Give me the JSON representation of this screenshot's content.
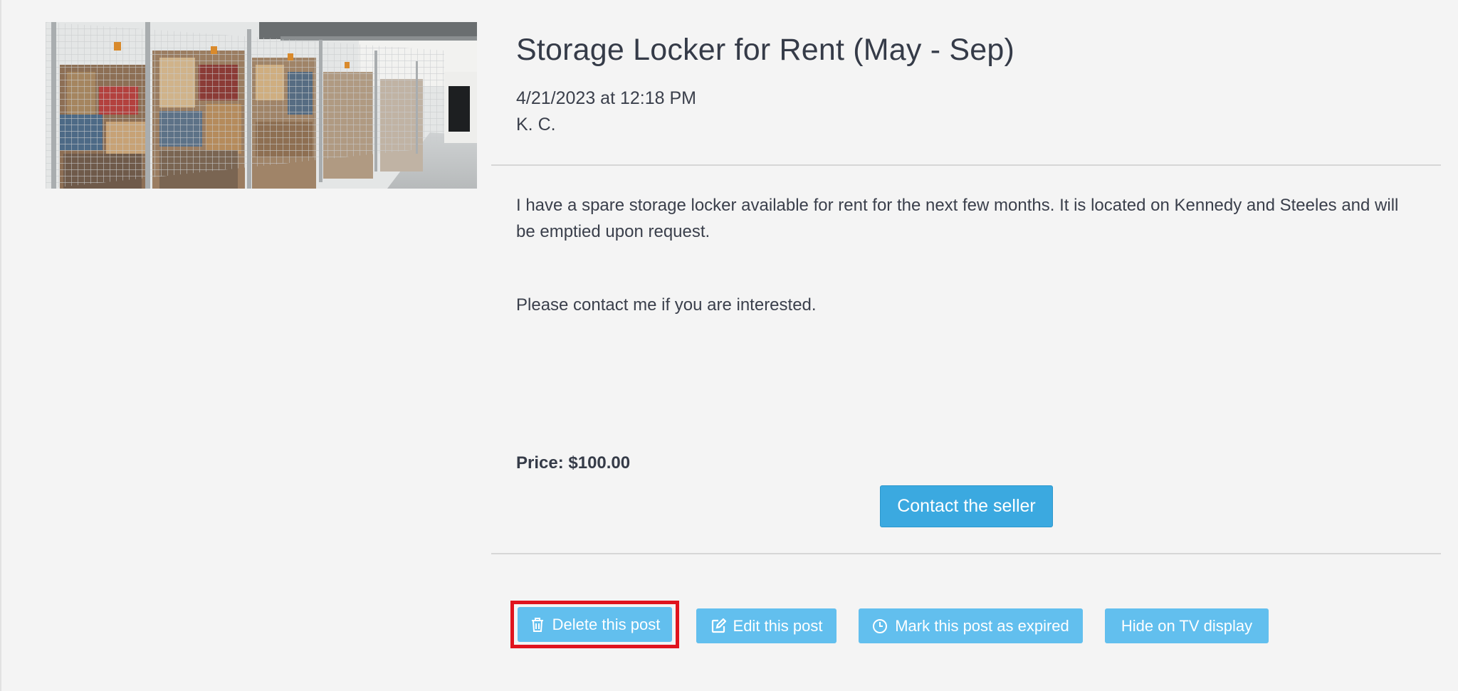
{
  "post": {
    "title": "Storage Locker for Rent (May - Sep)",
    "timestamp": "4/21/2023 at 12:18 PM",
    "author": "K. C.",
    "description": "I have a spare storage locker available for rent for the next few months. It is located on Kennedy and Steeles and will be emptied upon request.",
    "contact_line": "Please contact me if you are interested.",
    "price": "Price: $100.00",
    "contact_button": "Contact the seller"
  },
  "actions": {
    "delete": "Delete this post",
    "edit": "Edit this post",
    "expire": "Mark this post as expired",
    "hide": "Hide on TV display"
  },
  "colors": {
    "background": "#f4f4f4",
    "primary_button": "#3ba9e0",
    "action_button": "#62bfee",
    "highlight_frame": "#e0141e"
  },
  "icons": {
    "delete": "trash-icon",
    "edit": "edit-icon",
    "expire": "clock-icon"
  }
}
